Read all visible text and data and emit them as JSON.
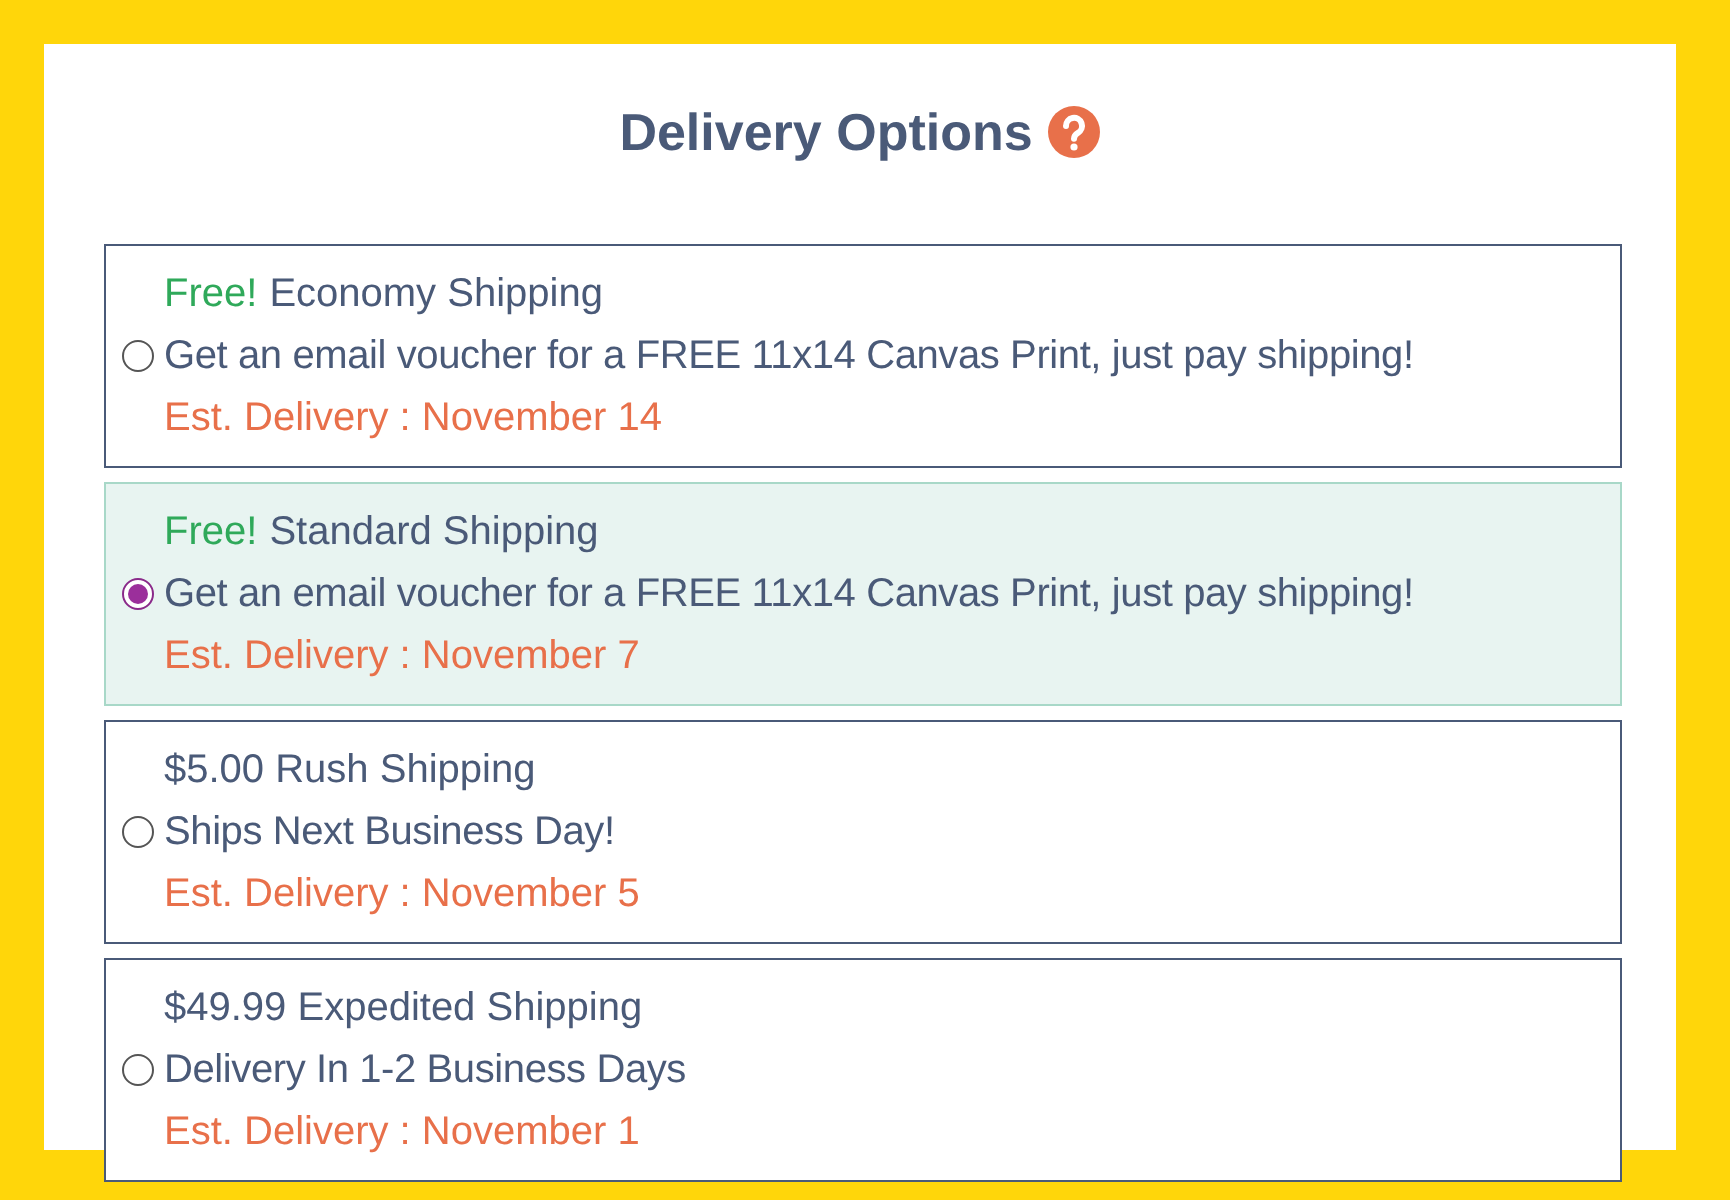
{
  "title": "Delivery Options",
  "options": [
    {
      "badge": "Free!",
      "name": "Economy Shipping",
      "description": "Get an email voucher for a FREE 11x14 Canvas Print, just pay shipping!",
      "estimate": "Est. Delivery : November 14",
      "selected": false
    },
    {
      "badge": "Free!",
      "name": "Standard Shipping",
      "description": "Get an email voucher for a FREE 11x14 Canvas Print, just pay shipping!",
      "estimate": "Est. Delivery : November 7",
      "selected": true
    },
    {
      "name": "$5.00 Rush Shipping",
      "description": "Ships Next Business Day!",
      "estimate": "Est. Delivery : November 5",
      "selected": false
    },
    {
      "name": "$49.99 Expedited Shipping",
      "description": "Delivery In 1-2 Business Days",
      "estimate": "Est. Delivery : November 1",
      "selected": false
    }
  ]
}
